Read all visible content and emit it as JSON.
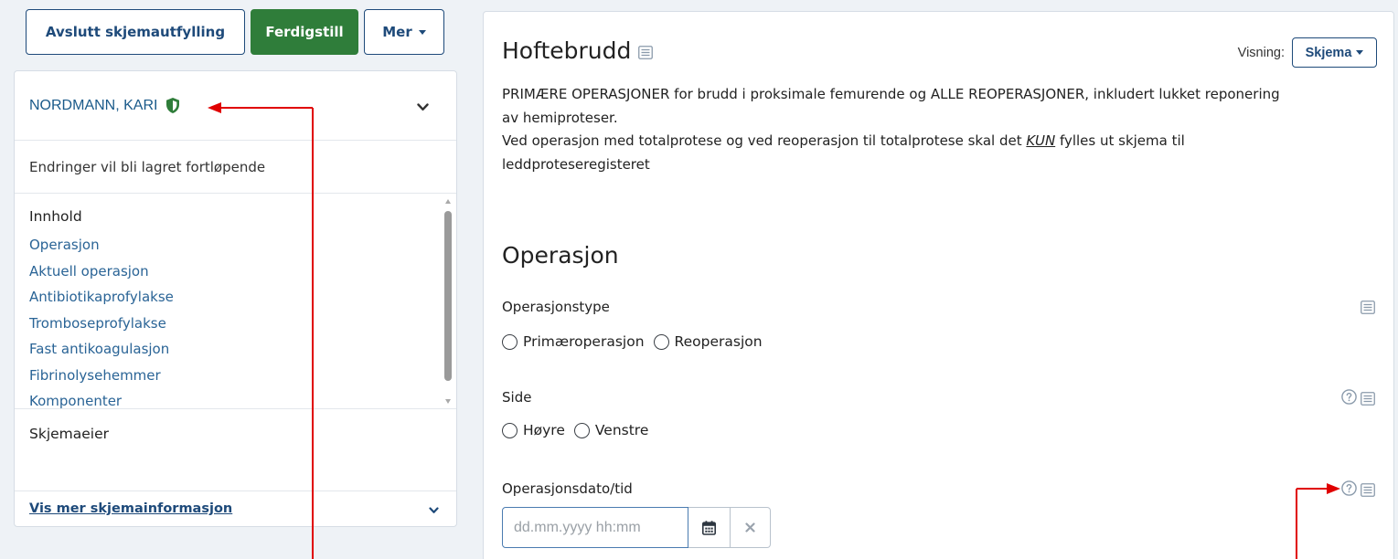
{
  "toolbar": {
    "exit_label": "Avslutt skjemautfylling",
    "finish_label": "Ferdigstill",
    "more_label": "Mer"
  },
  "sidebar": {
    "patient_name": "NORDMANN, KARI",
    "save_notice": "Endringer vil bli lagret fortløpende",
    "contents_heading": "Innhold",
    "contents_items": [
      "Operasjon",
      "Aktuell operasjon",
      "Antibiotikaprofylakse",
      "Tromboseprofylakse",
      "Fast antikoagulasjon",
      "Fibrinolysehemmer",
      "Komponenter"
    ],
    "owner_heading": "Skjemaeier",
    "more_info_link": "Vis mer skjemainformasjon"
  },
  "form": {
    "title": "Hoftebrudd",
    "view_label": "Visning:",
    "view_value": "Skjema",
    "description_line1": "PRIMÆRE OPERASJONER for brudd i proksimale femurende og ALLE REOPERASJONER, inkludert lukket reponering av hemiproteser.",
    "description_line2_before": "Ved operasjon med totalprotese og ved reoperasjon til totalprotese skal det ",
    "description_line2_emphasis": "KUN",
    "description_line2_after": " fylles ut skjema til leddproteseregisteret",
    "section_title": "Operasjon",
    "fields": {
      "operasjonstype": {
        "label": "Operasjonstype",
        "options": [
          "Primæroperasjon",
          "Reoperasjon"
        ]
      },
      "side": {
        "label": "Side",
        "options": [
          "Høyre",
          "Venstre"
        ]
      },
      "operasjonsdato": {
        "label": "Operasjonsdato/tid",
        "placeholder": "dd.mm.yyyy hh:mm"
      }
    }
  },
  "colors": {
    "primary": "#1e4a7a",
    "success": "#2f7d3a",
    "link": "#2a6496",
    "annotation_arrow": "#e00000"
  }
}
